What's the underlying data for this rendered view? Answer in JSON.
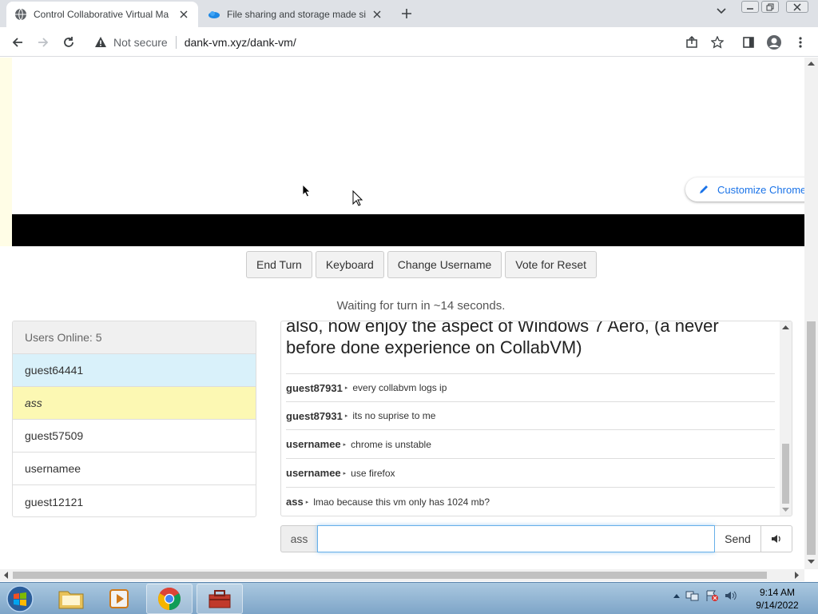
{
  "browser": {
    "tabs": [
      {
        "title": "Control Collaborative Virtual Ma",
        "icon": "globe-icon",
        "active": true
      },
      {
        "title": "File sharing and storage made si",
        "icon": "cloud-icon",
        "active": false
      }
    ],
    "security_label": "Not secure",
    "url": "dank-vm.xyz/dank-vm/"
  },
  "vm": {
    "customize_chrome_label": "Customize Chrome"
  },
  "controls": {
    "end_turn": "End Turn",
    "keyboard": "Keyboard",
    "change_username": "Change Username",
    "vote_reset": "Vote for Reset"
  },
  "turn_status": "Waiting for turn in ~14 seconds.",
  "users": {
    "header": "Users Online: 5",
    "list": [
      {
        "name": "guest64441"
      },
      {
        "name": "ass"
      },
      {
        "name": "guest57509"
      },
      {
        "name": "usernamee"
      },
      {
        "name": "guest12121"
      }
    ]
  },
  "chat": {
    "motd": "also, now enjoy the aspect of Windows 7 Aero, (a never before done experience on CollabVM)",
    "messages": [
      {
        "user": "guest87931",
        "text": "every collabvm logs ip"
      },
      {
        "user": "guest87931",
        "text": "its no suprise to me"
      },
      {
        "user": "usernamee",
        "text": "chrome is unstable"
      },
      {
        "user": "usernamee",
        "text": "use firefox"
      },
      {
        "user": "ass",
        "text": "lmao because this vm only has 1024 mb?"
      }
    ],
    "username": "ass",
    "input_value": "",
    "send_label": "Send"
  },
  "taskbar": {
    "time": "9:14 AM",
    "date": "9/14/2022"
  },
  "colors": {
    "my_user_row": "#d9f1fa",
    "turn_user_row": "#fcf8b3",
    "link_blue": "#1a73e8"
  }
}
